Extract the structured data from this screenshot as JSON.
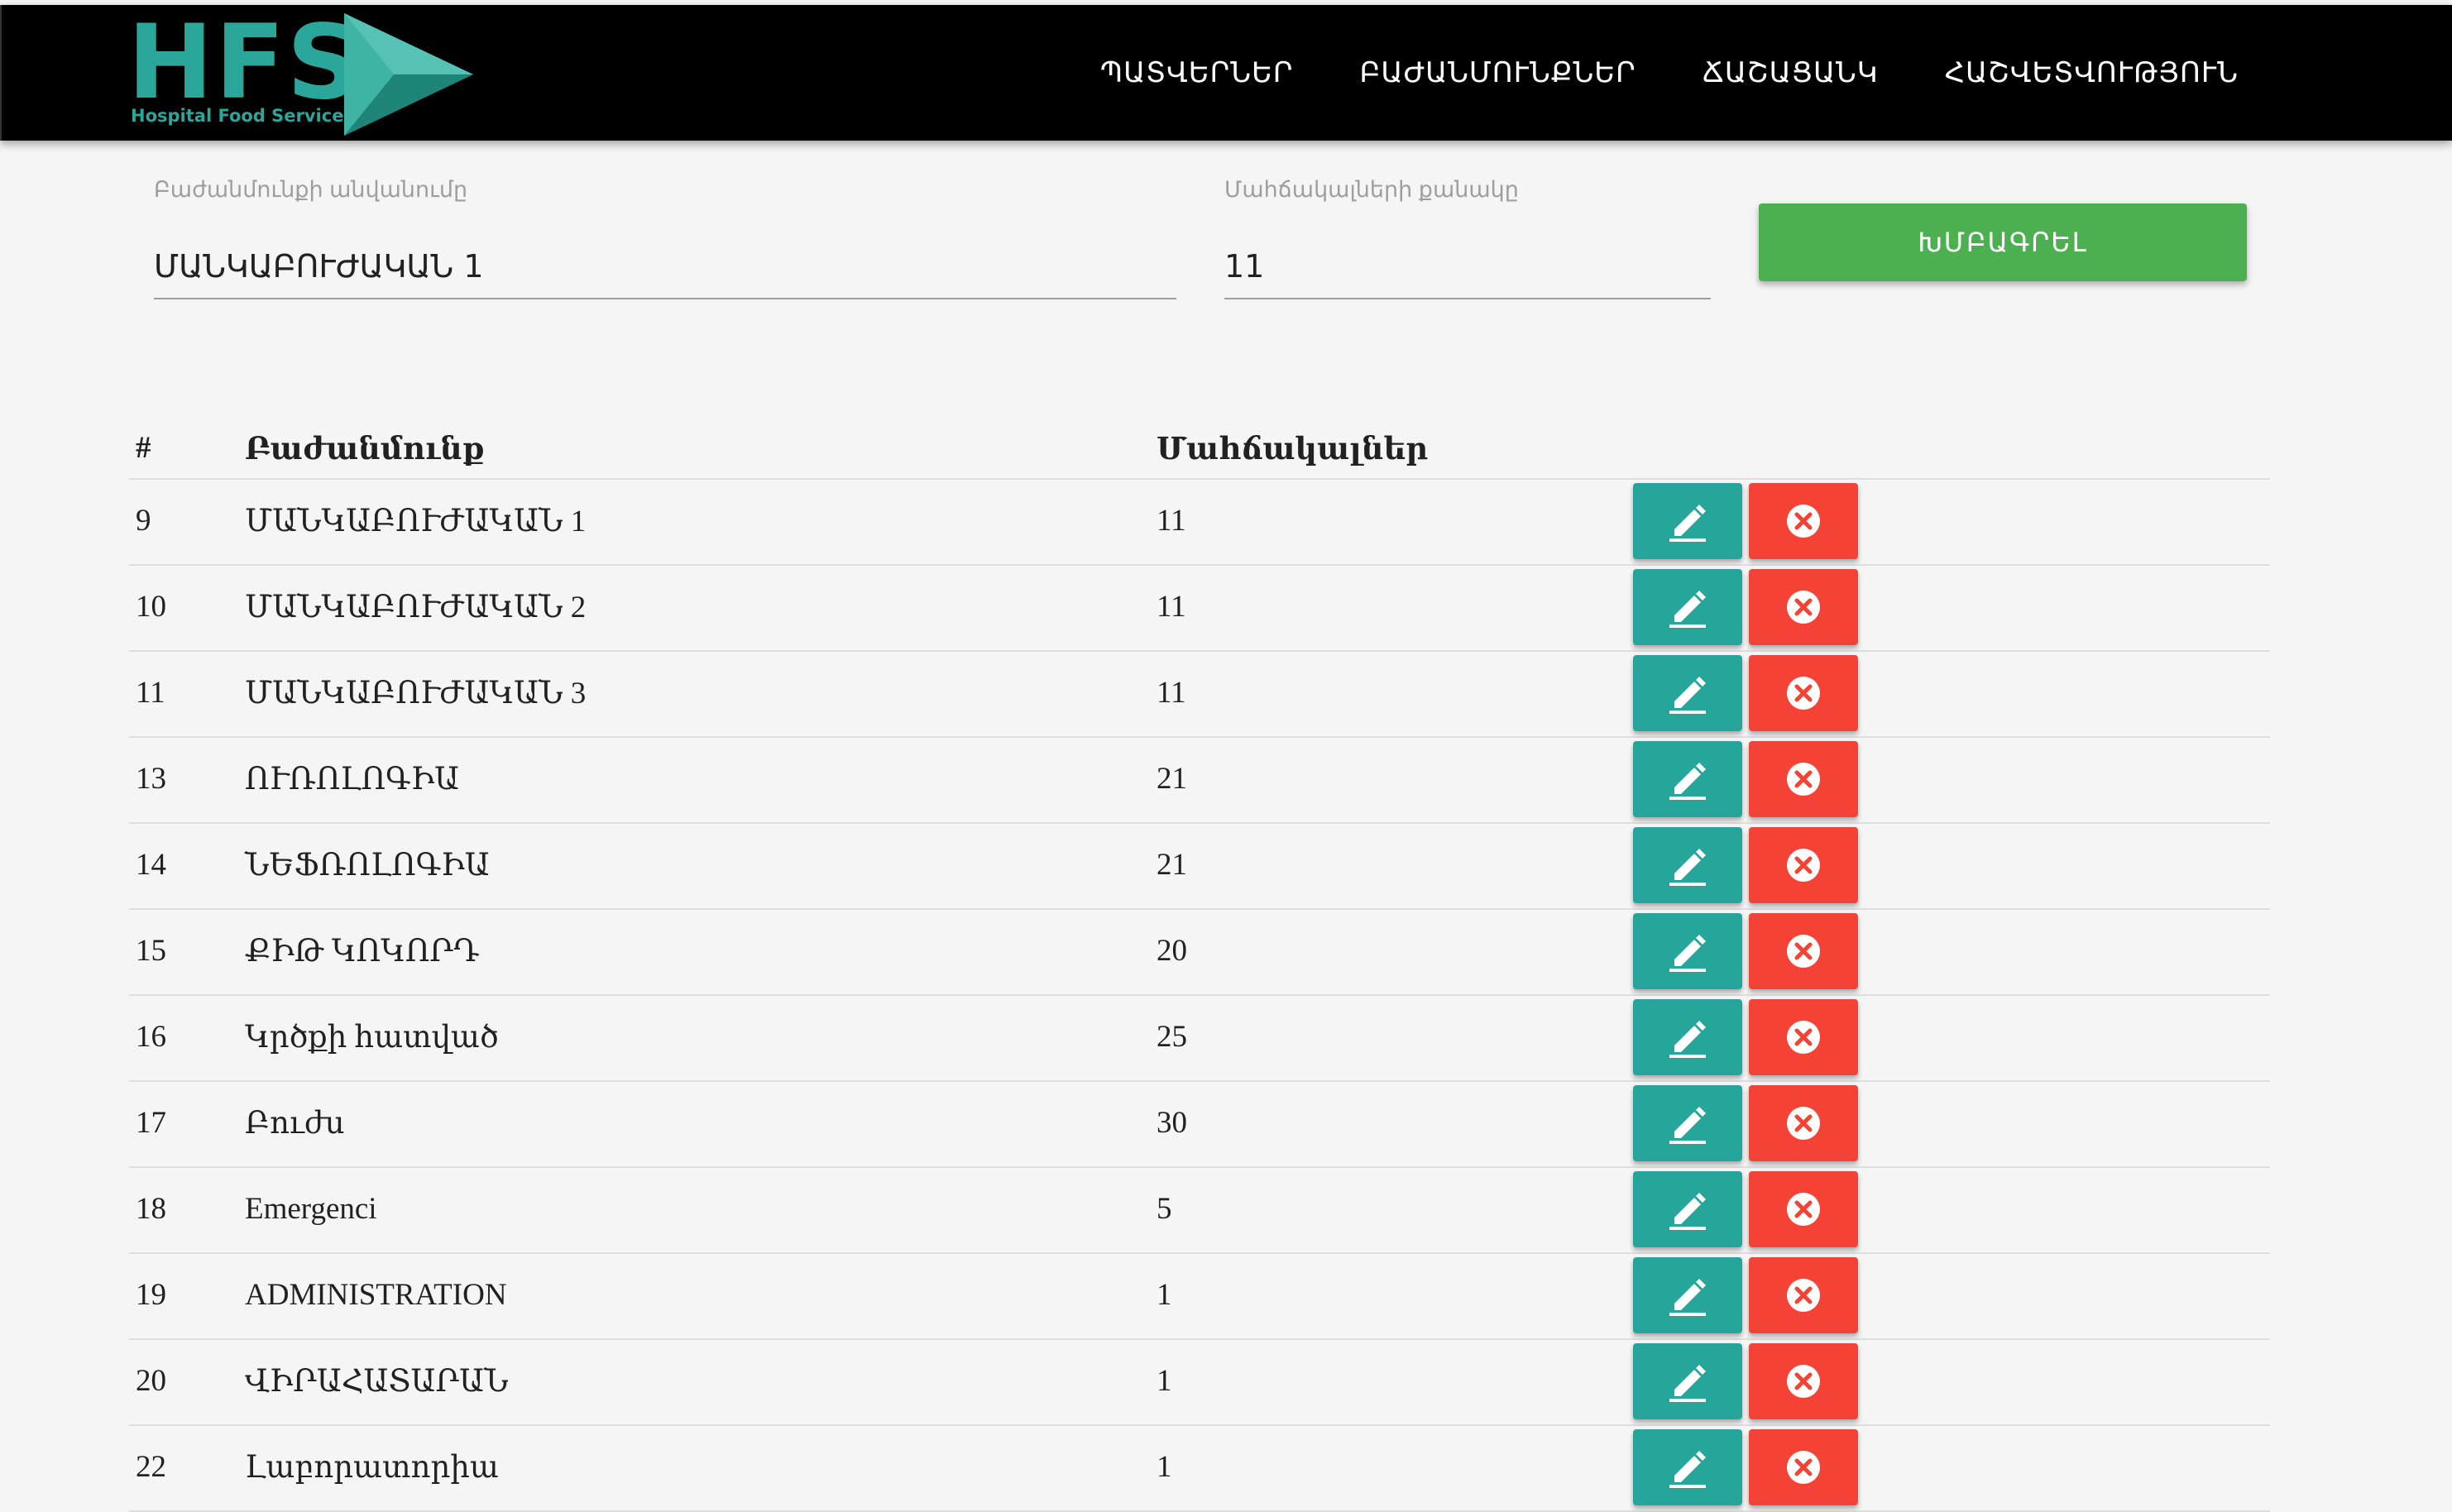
{
  "brand": {
    "logo_text": "HFS",
    "logo_subtitle": "Hospital Food Service"
  },
  "nav": {
    "items": [
      {
        "label": "ՊԱՏՎԵՐՆԵՐ"
      },
      {
        "label": "ԲԱԺԱՆՄՈՒՆՔՆԵՐ"
      },
      {
        "label": "ՃԱՇԱՑԱՆԿ"
      },
      {
        "label": "ՀԱՇՎԵՏՎՈՒԹՅՈՒՆ"
      }
    ]
  },
  "form": {
    "name_label": "Բաժանմունքի անվանումը",
    "name_value": "ՄԱՆԿԱԲՈՒԺԱԿԱՆ 1",
    "beds_label": "Մահճակալների քանակը",
    "beds_value": "11",
    "save_label": "ԽՄԲԱԳՐԵԼ"
  },
  "table": {
    "headers": {
      "id": "#",
      "name": "Բաժանմունք",
      "count": "Մահճակալներ"
    },
    "rows": [
      {
        "id": "9",
        "name": "ՄԱՆԿԱԲՈՒԺԱԿԱՆ 1",
        "count": "11"
      },
      {
        "id": "10",
        "name": "ՄԱՆԿԱԲՈՒԺԱԿԱՆ 2",
        "count": "11"
      },
      {
        "id": "11",
        "name": "ՄԱՆԿԱԲՈՒԺԱԿԱՆ 3",
        "count": "11"
      },
      {
        "id": "13",
        "name": "ՈՒՌՈԼՈԳԻԱ",
        "count": "21"
      },
      {
        "id": "14",
        "name": "ՆԵՖՌՈԼՈԳԻԱ",
        "count": "21"
      },
      {
        "id": "15",
        "name": "ՔԻԹ ԿՈԿՈՐԴ",
        "count": "20"
      },
      {
        "id": "16",
        "name": "Կրծքի հատված",
        "count": "25"
      },
      {
        "id": "17",
        "name": "Բուժս",
        "count": "30"
      },
      {
        "id": "18",
        "name": "Emergenci",
        "count": "5"
      },
      {
        "id": "19",
        "name": "ADMINISTRATION",
        "count": "1"
      },
      {
        "id": "20",
        "name": "ՎԻՐԱՀԱՏԱՐԱՆ",
        "count": "1"
      },
      {
        "id": "22",
        "name": "Լաբորատորիա",
        "count": "1"
      }
    ]
  },
  "colors": {
    "navbar_bg": "#000000",
    "brand_teal": "#2ba69a",
    "save_green": "#4caf50",
    "edit_teal": "#26a69a",
    "delete_red": "#f44336"
  },
  "icons": {
    "edit": "pencil-icon",
    "delete": "close-circle-icon"
  }
}
